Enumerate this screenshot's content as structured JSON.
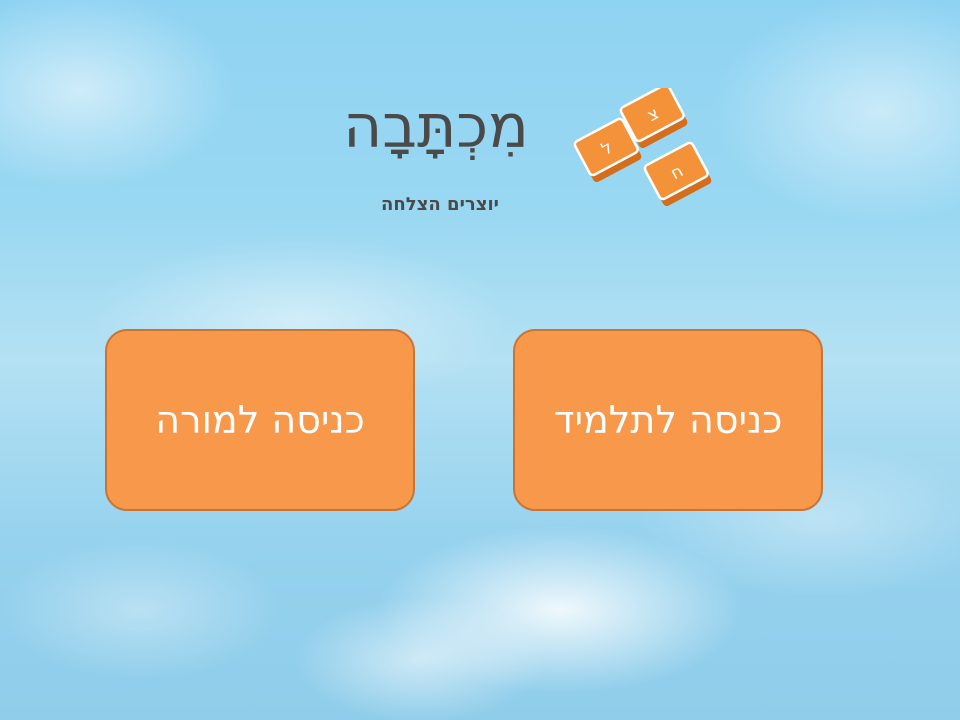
{
  "logo": {
    "wordmark": "מִכְתָּבָה",
    "tagline": "יוצרים הצלחה",
    "blocks": [
      "צ",
      "ל",
      "ח"
    ]
  },
  "buttons": {
    "teacher_label": "כניסה למורה",
    "student_label": "כניסה לתלמיד"
  },
  "colors": {
    "button_fill": "#f7984a",
    "button_border": "#c87437",
    "logo_block": "#f08a2e",
    "text_dark": "#4a4a4a"
  }
}
